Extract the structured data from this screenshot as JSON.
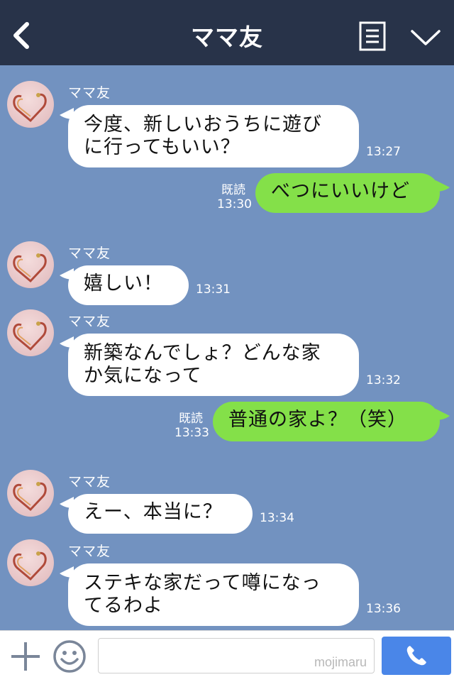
{
  "header": {
    "title": "ママ友"
  },
  "messages": [
    {
      "sender": "ママ友",
      "line1": "今度、新しいおうちに遊び",
      "line2": "に行ってもいい？",
      "time": "13:27"
    },
    {
      "text": "べつにいいけど",
      "read": "既読",
      "time": "13:30"
    },
    {
      "sender": "ママ友",
      "line1": "嬉しい！",
      "time": "13:31"
    },
    {
      "sender": "ママ友",
      "line1": "新築なんでしょ？どんな家",
      "line2": "か気になって",
      "time": "13:32"
    },
    {
      "text": "普通の家よ？（笑）",
      "read": "既読",
      "time": "13:33"
    },
    {
      "sender": "ママ友",
      "line1": "えー、本当に？",
      "time": "13:34"
    },
    {
      "sender": "ママ友",
      "line1": "ステキな家だって噂になっ",
      "line2": "てるわよ",
      "time": "13:36"
    }
  ],
  "footer": {
    "watermark": "mojimaru"
  },
  "colors": {
    "header_bg": "#283349",
    "chat_bg": "#7292c0",
    "incoming_bubble": "#ffffff",
    "outgoing_bubble": "#84e049",
    "call_button": "#4a86e8"
  },
  "icons": [
    "back-arrow-icon",
    "menu-list-icon",
    "chevron-down-icon",
    "plus-icon",
    "smiley-icon",
    "phone-icon"
  ]
}
